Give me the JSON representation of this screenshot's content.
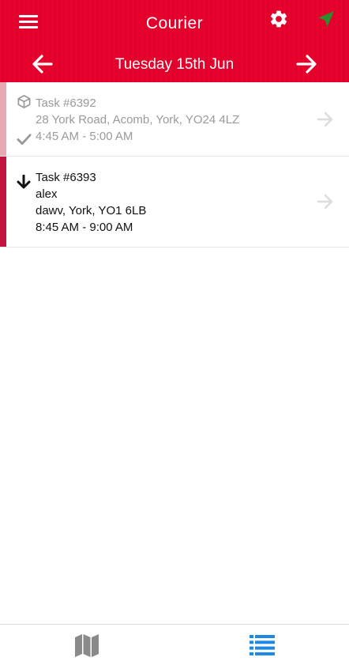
{
  "header": {
    "title": "Courier",
    "date": "Tuesday 15th Jun",
    "icons": {
      "menu": "menu-icon",
      "settings": "gear-icon",
      "navigation": "navigation-icon",
      "previous": "arrow-left-icon",
      "next": "arrow-right-icon"
    }
  },
  "tasks": [
    {
      "number": "Task #6392",
      "address": "28 York Road, Acomb, York, YO24 4LZ",
      "time": "4:45 AM - 5:00 AM",
      "status": "completed",
      "type_icon": "box-icon",
      "status_icon": "check-icon"
    },
    {
      "number": "Task #6393",
      "name": "alex",
      "address": "dawv, York, YO1 6LB",
      "time": "8:45 AM - 9:00 AM",
      "status": "pending",
      "type_icon": "arrow-down-icon"
    }
  ],
  "bottom_nav": {
    "items": [
      {
        "icon": "map-icon",
        "active": false
      },
      {
        "icon": "list-icon",
        "active": true
      }
    ]
  },
  "colors": {
    "brand": "#e4002b",
    "stripe_done": "#e8a8b4",
    "stripe_active": "#c2143e",
    "nav_active": "#1e88e5",
    "nav_inactive": "#8a8a8a",
    "navigation_icon": "#2e8b2e"
  }
}
